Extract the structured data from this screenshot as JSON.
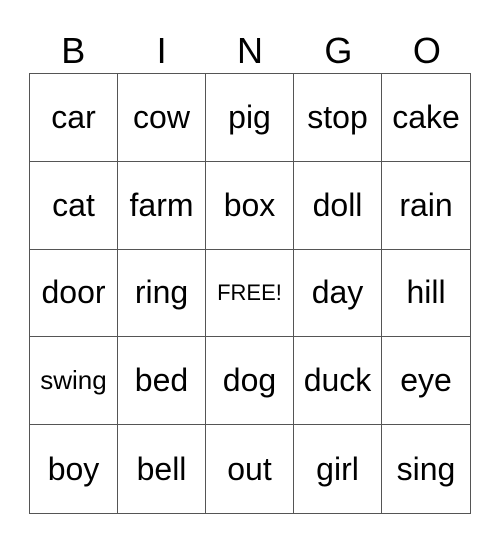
{
  "header": [
    "B",
    "I",
    "N",
    "G",
    "O"
  ],
  "rows": [
    [
      "car",
      "cow",
      "pig",
      "stop",
      "cake"
    ],
    [
      "cat",
      "farm",
      "box",
      "doll",
      "rain"
    ],
    [
      "door",
      "ring",
      "FREE!",
      "day",
      "hill"
    ],
    [
      "swing",
      "bed",
      "dog",
      "duck",
      "eye"
    ],
    [
      "boy",
      "bell",
      "out",
      "girl",
      "sing"
    ]
  ]
}
